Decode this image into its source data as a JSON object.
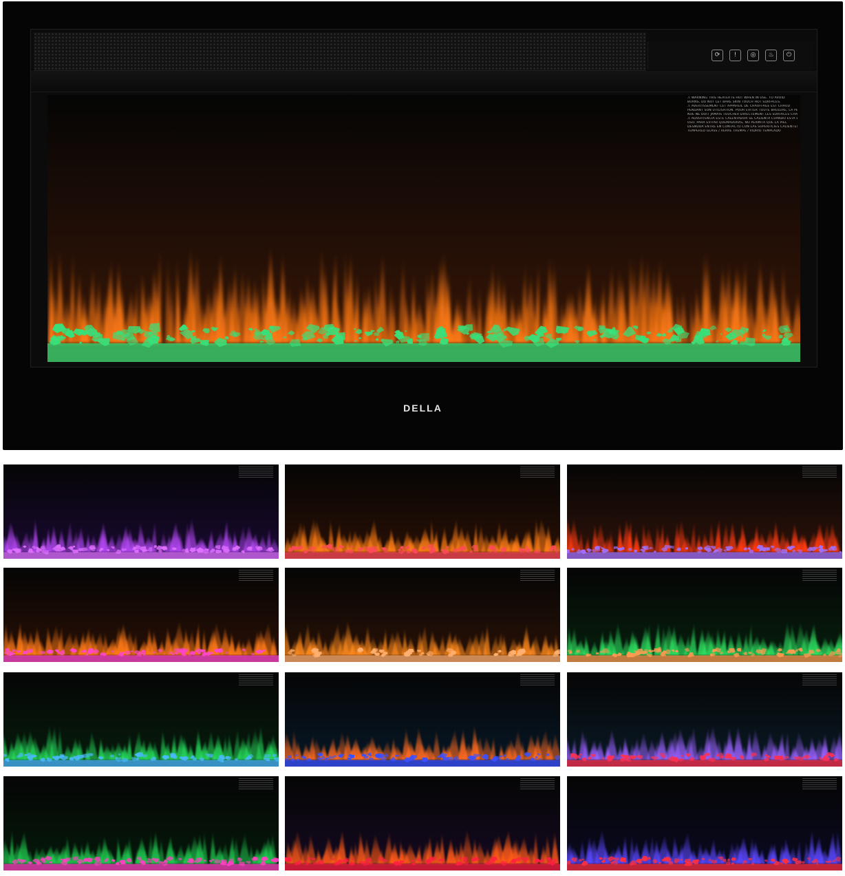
{
  "product": {
    "brand": "DELLA"
  },
  "controls": [
    {
      "icon": "timer-icon",
      "glyph": "⟳"
    },
    {
      "icon": "thermometer-icon",
      "glyph": "!"
    },
    {
      "icon": "heat-icon",
      "glyph": "◎"
    },
    {
      "icon": "flame-icon",
      "glyph": "♨"
    },
    {
      "icon": "power-icon",
      "glyph": "⏻"
    }
  ],
  "warning_label": {
    "lines": [
      "⚠ WARNING  THIS HEATER IS HOT WHEN IN USE. TO AVOID",
      "BURNS, DO NOT LET BARE SKIN TOUCH HOT SURFACES.",
      "⚠ AVERTISSEMENT  CET APPAREIL DE CHAUFFAGE EST CHAUD",
      "PENDANT SON UTILISATION. POUR EVITER TOUTE BRULURE, LA PEAU",
      "NUE NE DOIT JAMAIS TOUCHER DIRECTEMENT LES SURFACES CHAUDES.",
      "⚠ ADVERTENCIA  ESTE CALENTADOR SE CALIENTA CUANDO ESTA EN",
      "USO. PARA EVITAR QUEMADURAS, NO PERMITA QUE LA PIEL",
      "DESNUDA ENTRE EN CONTACTO CON LAS SUPERFICIES CALIENTES.",
      "TEMPERED GLASS / VERRE TREMPÉ / VIDRIO TEMPLADO"
    ]
  },
  "colors": {
    "main_flame": "#ff7a14",
    "main_ember": "#38e07a"
  },
  "variants": [
    {
      "flame": "#b146f0",
      "ember": "#e070ff",
      "ambient": "#1a0a33"
    },
    {
      "flame": "#ff7d16",
      "ember": "#ff4a5a",
      "ambient": "#2a1005"
    },
    {
      "flame": "#ff3a10",
      "ember": "#a070ff",
      "ambient": "#30130a"
    },
    {
      "flame": "#ff7a18",
      "ember": "#ff45d0",
      "ambient": "#2a1005"
    },
    {
      "flame": "#ff8a1c",
      "ember": "#ffb070",
      "ambient": "#2a1206"
    },
    {
      "flame": "#2ee060",
      "ember": "#ff9a50",
      "ambient": "#06200d"
    },
    {
      "flame": "#25d85a",
      "ember": "#4ab8ff",
      "ambient": "#061d0c"
    },
    {
      "flame": "#ff6a20",
      "ember": "#3a50ff",
      "ambient": "#071827"
    },
    {
      "flame": "#9a60ff",
      "ember": "#ff3050",
      "ambient": "#0a1a26"
    },
    {
      "flame": "#20c850",
      "ember": "#ff40c0",
      "ambient": "#051a0a"
    },
    {
      "flame": "#ff5a18",
      "ember": "#ff2040",
      "ambient": "#150a22"
    },
    {
      "flame": "#5a48ff",
      "ember": "#ff3040",
      "ambient": "#0a0a22"
    }
  ]
}
